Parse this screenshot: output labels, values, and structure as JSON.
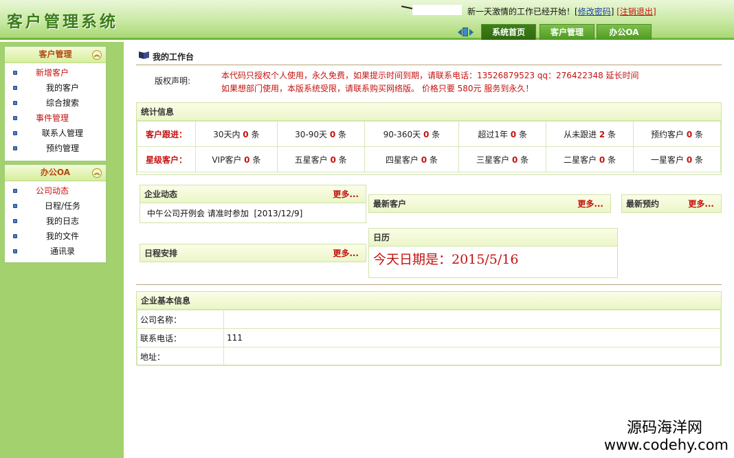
{
  "header": {
    "logo": "客户管理系统",
    "welcome": "新一天激情的工作已经开始！",
    "change_password": "修改密码",
    "logout": "注销退出",
    "bracket_open": "[",
    "bracket_close": "]",
    "tabs": [
      "系统首页",
      "客户管理",
      "办公OA"
    ]
  },
  "sidebar": {
    "panels": [
      {
        "title": "客户管理",
        "items": [
          {
            "label": "新增客户",
            "kind": "category"
          },
          {
            "label": "我的客户",
            "kind": "sub"
          },
          {
            "label": "综合搜索",
            "kind": "sub"
          },
          {
            "label": "事件管理",
            "kind": "category"
          },
          {
            "label": "联系人管理",
            "kind": "sub"
          },
          {
            "label": "预约管理",
            "kind": "sub"
          }
        ]
      },
      {
        "title": "办公OA",
        "items": [
          {
            "label": "公司动态",
            "kind": "category"
          },
          {
            "label": "日程/任务",
            "kind": "sub"
          },
          {
            "label": "我的日志",
            "kind": "sub"
          },
          {
            "label": "我的文件",
            "kind": "sub"
          },
          {
            "label": "通讯录",
            "kind": "sub"
          }
        ]
      }
    ],
    "collapse_glyph": "︽"
  },
  "main": {
    "title": "我的工作台",
    "copyright_label": "版权声明:",
    "copyright_lines": [
      "本代码只授权个人使用，永久免费，如果提示时间到期，请联系电话：13526879523 qq：276422348 延长时间",
      "如果想部门使用，本版系统受限，请联系购买网络版。 价格只要 580元 服务到永久！"
    ],
    "stats": {
      "title": "统计信息",
      "rows": [
        {
          "header": "客户跟进：",
          "cells": [
            {
              "pre": "30天内 ",
              "num": "0",
              "post": " 条"
            },
            {
              "pre": "30-90天 ",
              "num": "0",
              "post": " 条"
            },
            {
              "pre": "90-360天 ",
              "num": "0",
              "post": " 条"
            },
            {
              "pre": "超过1年 ",
              "num": "0",
              "post": " 条"
            },
            {
              "pre": "从未跟进 ",
              "num": "2",
              "post": " 条"
            },
            {
              "pre": "预约客户 ",
              "num": "0",
              "post": " 条"
            }
          ]
        },
        {
          "header": "星级客户：",
          "cells": [
            {
              "pre": "VIP客户 ",
              "num": "0",
              "post": " 条"
            },
            {
              "pre": "五星客户 ",
              "num": "0",
              "post": " 条"
            },
            {
              "pre": "四星客户 ",
              "num": "0",
              "post": " 条"
            },
            {
              "pre": "三星客户 ",
              "num": "0",
              "post": " 条"
            },
            {
              "pre": "二星客户 ",
              "num": "0",
              "post": " 条"
            },
            {
              "pre": "一星客户 ",
              "num": "0",
              "post": " 条"
            }
          ]
        }
      ]
    },
    "more": "更多...",
    "news": {
      "title": "企业动态",
      "items": [
        {
          "text": "中午公司开例会 请准时参加",
          "date": "[2013/12/9]"
        }
      ]
    },
    "newest_customers": {
      "title": "最新客户"
    },
    "newest_appointments": {
      "title": "最新预约"
    },
    "schedule": {
      "title": "日程安排"
    },
    "calendar": {
      "title": "日历",
      "text": "今天日期是：2015/5/16"
    },
    "company": {
      "title": "企业基本信息",
      "rows": [
        {
          "key": "公司名称：",
          "value": ""
        },
        {
          "key": "联系电话：",
          "value": "111"
        },
        {
          "key": "地址：",
          "value": ""
        }
      ]
    }
  },
  "watermark": {
    "line1": "源码海洋网",
    "line2": "www.codehy.com"
  },
  "colors": {
    "accent_red": "#c4120f",
    "sidebar_green": "#a3d16d",
    "header_green": "#6fb83a"
  }
}
